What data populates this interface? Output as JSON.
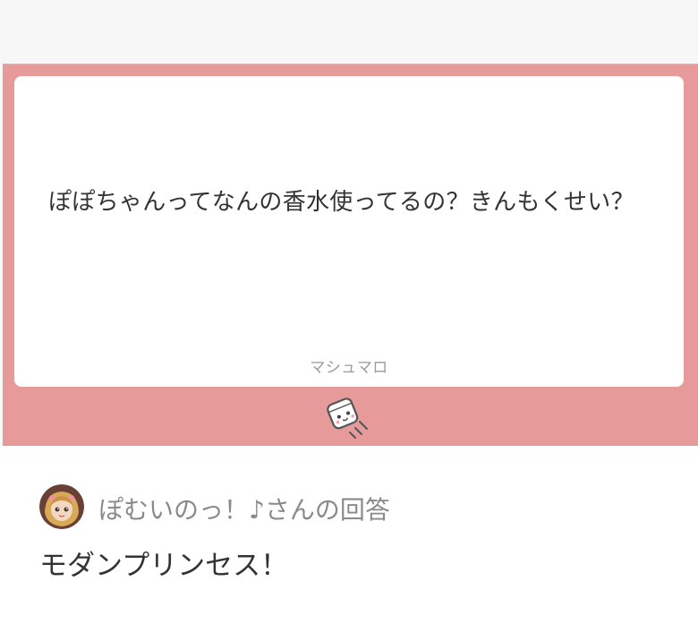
{
  "question": {
    "text": "ぽぽちゃんってなんの香水使ってるの？きんもくせい？",
    "brand_label": "マシュマロ"
  },
  "answer": {
    "answerer_label": "ぽむいのっ！♪さんの回答",
    "text": "モダンプリンセス！"
  },
  "icons": {
    "mascot": "marshmallow-mascot-icon",
    "avatar": "avatar"
  },
  "colors": {
    "frame": "#e79a9a",
    "card": "#ffffff",
    "page_background": "#f7f7f7",
    "question_text": "#333333",
    "muted_text": "#8a8a8a"
  }
}
